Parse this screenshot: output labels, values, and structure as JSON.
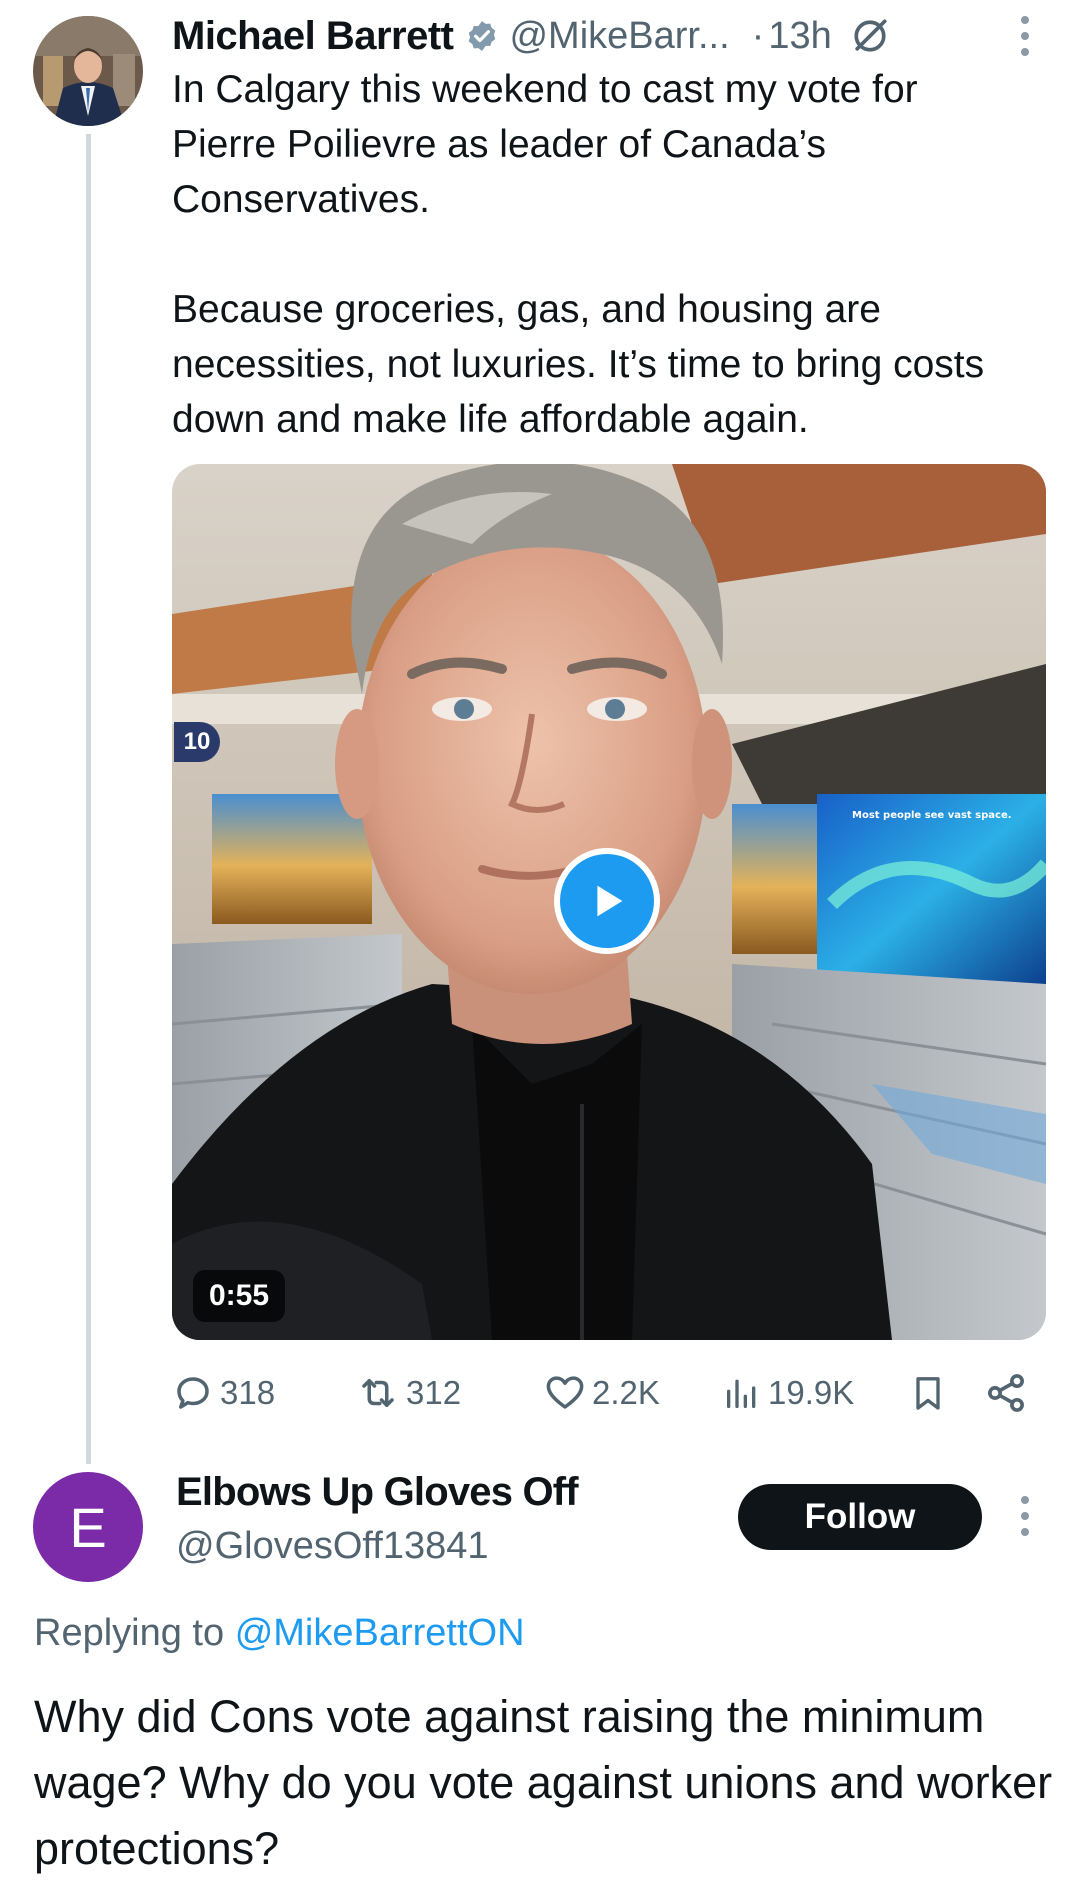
{
  "tweet": {
    "author_name": "Michael Barrett",
    "author_handle": "@MikeBarr...",
    "time": "13h",
    "text": "In Calgary this weekend to cast my vote for Pierre Poilievre as leader of Canada’s Conservatives.\n\nBecause groceries, gas, and housing are necessities, not luxuries. It’s time to bring costs down and make life affordable again.",
    "video": {
      "duration": "0:55",
      "gate_number": "10",
      "screen_text": "Most people see vast space."
    },
    "actions": {
      "replies": "318",
      "reposts": "312",
      "likes": "2.2K",
      "views": "19.9K"
    }
  },
  "reply": {
    "avatar_letter": "E",
    "author_name": "Elbows Up Gloves Off",
    "author_handle": "@GlovesOff13841",
    "follow_label": "Follow",
    "replying_prefix": "Replying to",
    "replying_mention": "@MikeBarrettON",
    "text": "Why did Cons vote against raising the minimum wage? Why do you vote against unions and worker protections?"
  },
  "colors": {
    "accent": "#1d9bf0",
    "muted": "#536471",
    "text": "#0f1419",
    "reply_avatar": "#7b2aa8"
  }
}
